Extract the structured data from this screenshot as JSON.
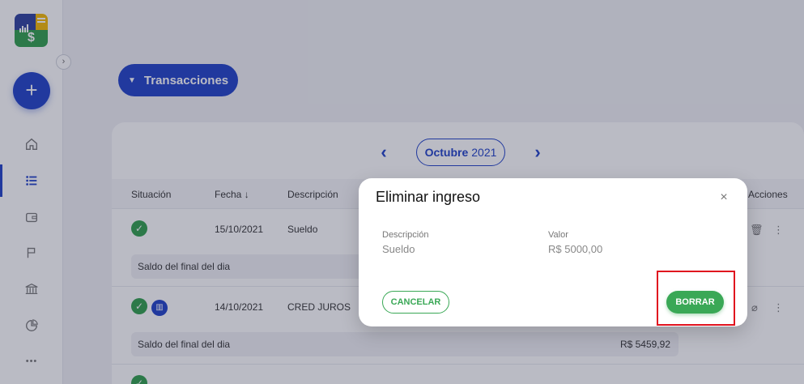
{
  "sidebar": {
    "collapse_icon": "chevron-right-icon",
    "add_label": "+",
    "nav": [
      {
        "name": "home-icon"
      },
      {
        "name": "list-icon",
        "active": true
      },
      {
        "name": "wallet-icon"
      },
      {
        "name": "flag-icon"
      },
      {
        "name": "bank-icon"
      },
      {
        "name": "pie-chart-icon"
      },
      {
        "name": "more-icon",
        "label": "•••"
      }
    ]
  },
  "header": {
    "transactions_label": "Transacciones"
  },
  "month": {
    "name": "Octubre",
    "year": "2021"
  },
  "table": {
    "columns": [
      "Situación",
      "Fecha",
      "Descripción",
      "Acciones"
    ],
    "sort_indicator": "↓",
    "rows": [
      {
        "date": "15/10/2021",
        "description": "Sueldo"
      },
      {
        "date": "14/10/2021",
        "description": "CRED JUROS"
      }
    ],
    "saldo_label": "Saldo del final del dia",
    "saldo_second_value": "R$ 5459,92"
  },
  "modal": {
    "title": "Eliminar ingreso",
    "close": "×",
    "desc_label": "Descripción",
    "desc_value": "Sueldo",
    "value_label": "Valor",
    "value_value": "R$ 5000,00",
    "cancel_label": "CANCELAR",
    "delete_label": "BORRAR"
  },
  "colors": {
    "primary": "#1e40c8",
    "success": "#3aa856",
    "highlight": "#e0131f"
  }
}
